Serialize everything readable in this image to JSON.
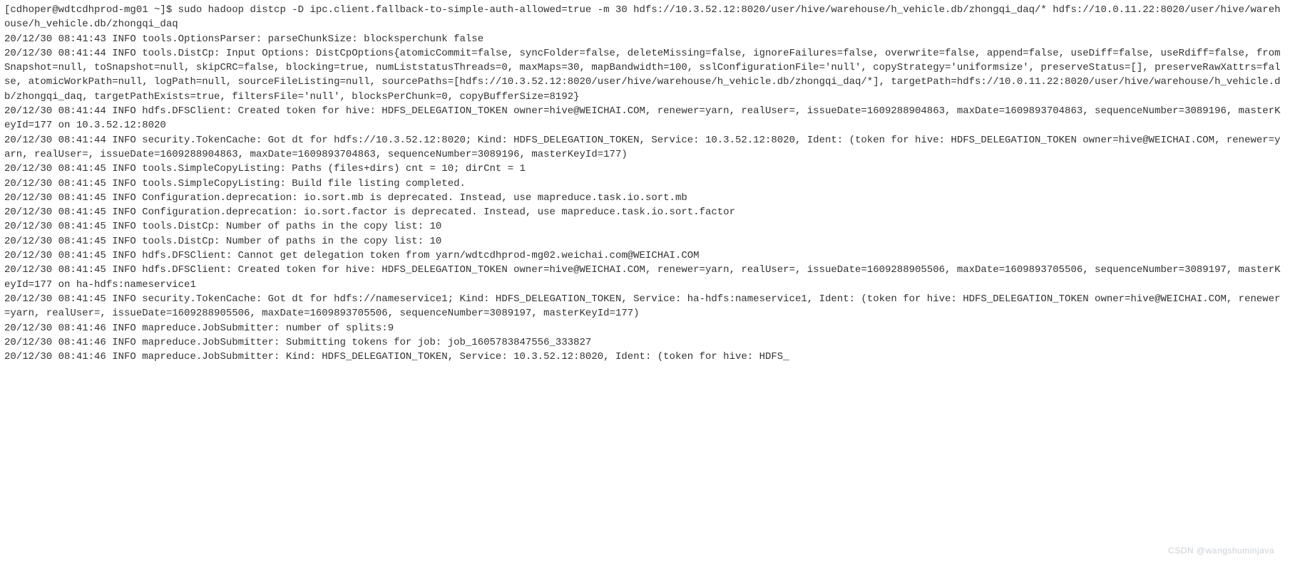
{
  "terminal": {
    "lines": [
      "[cdhoper@wdtcdhprod-mg01 ~]$ sudo hadoop distcp -D ipc.client.fallback-to-simple-auth-allowed=true -m 30 hdfs://10.3.52.12:8020/user/hive/warehouse/h_vehicle.db/zhongqi_daq/* hdfs://10.0.11.22:8020/user/hive/warehouse/h_vehicle.db/zhongqi_daq",
      "20/12/30 08:41:43 INFO tools.OptionsParser: parseChunkSize: blocksperchunk false",
      "20/12/30 08:41:44 INFO tools.DistCp: Input Options: DistCpOptions{atomicCommit=false, syncFolder=false, deleteMissing=false, ignoreFailures=false, overwrite=false, append=false, useDiff=false, useRdiff=false, fromSnapshot=null, toSnapshot=null, skipCRC=false, blocking=true, numListstatusThreads=0, maxMaps=30, mapBandwidth=100, sslConfigurationFile='null', copyStrategy='uniformsize', preserveStatus=[], preserveRawXattrs=false, atomicWorkPath=null, logPath=null, sourceFileListing=null, sourcePaths=[hdfs://10.3.52.12:8020/user/hive/warehouse/h_vehicle.db/zhongqi_daq/*], targetPath=hdfs://10.0.11.22:8020/user/hive/warehouse/h_vehicle.db/zhongqi_daq, targetPathExists=true, filtersFile='null', blocksPerChunk=0, copyBufferSize=8192}",
      "20/12/30 08:41:44 INFO hdfs.DFSClient: Created token for hive: HDFS_DELEGATION_TOKEN owner=hive@WEICHAI.COM, renewer=yarn, realUser=, issueDate=1609288904863, maxDate=1609893704863, sequenceNumber=3089196, masterKeyId=177 on 10.3.52.12:8020",
      "20/12/30 08:41:44 INFO security.TokenCache: Got dt for hdfs://10.3.52.12:8020; Kind: HDFS_DELEGATION_TOKEN, Service: 10.3.52.12:8020, Ident: (token for hive: HDFS_DELEGATION_TOKEN owner=hive@WEICHAI.COM, renewer=yarn, realUser=, issueDate=1609288904863, maxDate=1609893704863, sequenceNumber=3089196, masterKeyId=177)",
      "20/12/30 08:41:45 INFO tools.SimpleCopyListing: Paths (files+dirs) cnt = 10; dirCnt = 1",
      "20/12/30 08:41:45 INFO tools.SimpleCopyListing: Build file listing completed.",
      "20/12/30 08:41:45 INFO Configuration.deprecation: io.sort.mb is deprecated. Instead, use mapreduce.task.io.sort.mb",
      "20/12/30 08:41:45 INFO Configuration.deprecation: io.sort.factor is deprecated. Instead, use mapreduce.task.io.sort.factor",
      "20/12/30 08:41:45 INFO tools.DistCp: Number of paths in the copy list: 10",
      "20/12/30 08:41:45 INFO tools.DistCp: Number of paths in the copy list: 10",
      "20/12/30 08:41:45 INFO hdfs.DFSClient: Cannot get delegation token from yarn/wdtcdhprod-mg02.weichai.com@WEICHAI.COM",
      "20/12/30 08:41:45 INFO hdfs.DFSClient: Created token for hive: HDFS_DELEGATION_TOKEN owner=hive@WEICHAI.COM, renewer=yarn, realUser=, issueDate=1609288905506, maxDate=1609893705506, sequenceNumber=3089197, masterKeyId=177 on ha-hdfs:nameservice1",
      "20/12/30 08:41:45 INFO security.TokenCache: Got dt for hdfs://nameservice1; Kind: HDFS_DELEGATION_TOKEN, Service: ha-hdfs:nameservice1, Ident: (token for hive: HDFS_DELEGATION_TOKEN owner=hive@WEICHAI.COM, renewer=yarn, realUser=, issueDate=1609288905506, maxDate=1609893705506, sequenceNumber=3089197, masterKeyId=177)",
      "20/12/30 08:41:46 INFO mapreduce.JobSubmitter: number of splits:9",
      "20/12/30 08:41:46 INFO mapreduce.JobSubmitter: Submitting tokens for job: job_1605783847556_333827",
      "20/12/30 08:41:46 INFO mapreduce.JobSubmitter: Kind: HDFS_DELEGATION_TOKEN, Service: 10.3.52.12:8020, Ident: (token for hive: HDFS_"
    ]
  },
  "watermark": "CSDN @wangshuminjava"
}
